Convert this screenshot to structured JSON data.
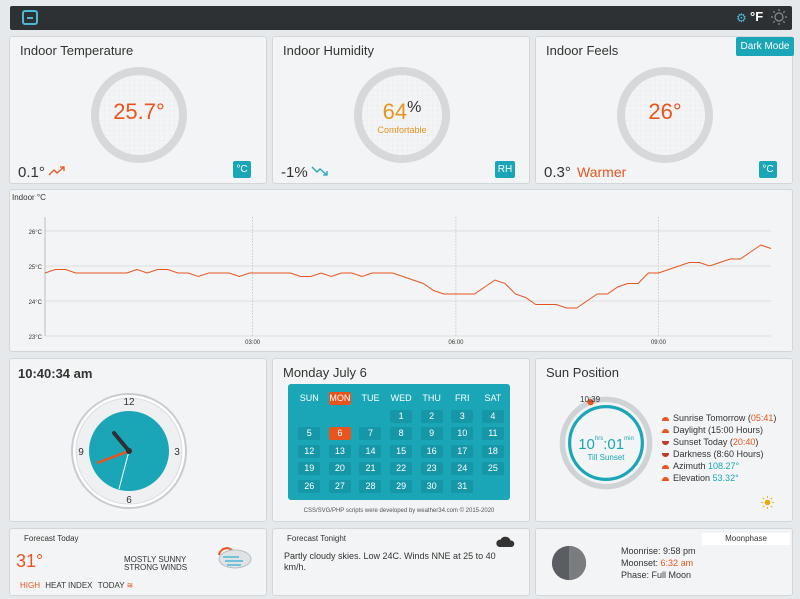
{
  "topbar": {
    "unit": "°F",
    "logo": "station-logo-icon",
    "toggle": "sun-icon"
  },
  "colors": {
    "accent": "#1aa6b7",
    "warm": "#e8541e",
    "comfort": "#e8941e",
    "bar": "#2e3134"
  },
  "temperature": {
    "title": "Indoor Temperature",
    "value": "25.7°",
    "change": "0.1°",
    "trend_icon": "trend-up-icon",
    "unit": "°C"
  },
  "humidity": {
    "title": "Indoor Humidity",
    "value": "64",
    "percent": "%",
    "status": "Comfortable",
    "change": "-1%",
    "trend_icon": "trend-down-icon",
    "unit": "RH"
  },
  "feels": {
    "title": "Indoor Feels",
    "value": "26°",
    "change": "0.3°",
    "status": "Warmer",
    "unit": "°C",
    "dark_mode": "Dark Mode"
  },
  "chart": {
    "label": "Indoor  °C",
    "chart_data": {
      "type": "line",
      "title": "",
      "xlabel": "",
      "ylabel": "°C",
      "ylim": [
        23,
        26
      ],
      "yticks": [
        "26°C",
        "25°C",
        "24°C",
        "23°C"
      ],
      "xticks": [
        "03:00",
        "06:00",
        "09:00"
      ],
      "grid": true,
      "series": [
        {
          "values": [
            24.8,
            24.9,
            24.9,
            24.8,
            24.8,
            24.8,
            24.8,
            24.8,
            24.8,
            24.9,
            24.8,
            24.9,
            24.9,
            24.8,
            24.8,
            24.7,
            24.8,
            24.8,
            24.8,
            24.7,
            24.8,
            24.8,
            24.8,
            24.8,
            24.8,
            24.7,
            24.7,
            24.8,
            24.7,
            24.8,
            24.8,
            24.7,
            24.8,
            24.8,
            24.8,
            24.7,
            24.6,
            24.5,
            24.3,
            24.2,
            24.2,
            24.2,
            24.2,
            24.4,
            24.6,
            24.5,
            24.2,
            24.1,
            23.9,
            23.9,
            23.9,
            23.8,
            23.8,
            24.0,
            24.2,
            24.2,
            24.4,
            24.5,
            24.5,
            24.8,
            24.8,
            24.9,
            25.0,
            25.1,
            25.1,
            25.0,
            25.1,
            25.2,
            25.2,
            25.4,
            25.6,
            25.5
          ]
        }
      ]
    }
  },
  "clock": {
    "time": "10:40:34 am",
    "numerals": [
      "12",
      "3",
      "6",
      "9"
    ]
  },
  "calendar": {
    "title": "Monday July 6",
    "days": [
      "SUN",
      "MON",
      "TUE",
      "WED",
      "THU",
      "FRI",
      "SAT"
    ],
    "today_index": 1,
    "cells": [
      "",
      "",
      "",
      "1",
      "2",
      "3",
      "4",
      "5",
      "6",
      "7",
      "8",
      "9",
      "10",
      "11",
      "12",
      "13",
      "14",
      "15",
      "16",
      "17",
      "18",
      "19",
      "20",
      "21",
      "22",
      "23",
      "24",
      "25",
      "26",
      "27",
      "28",
      "29",
      "30",
      "31",
      ""
    ],
    "today": "6",
    "credit": "CSS/SVG/PHP scripts were developed by weather34.com © 2015-2020"
  },
  "sun": {
    "title": "Sun Position",
    "dial_time": "10:39",
    "hrs": "10",
    "hrs_unit": "hrs",
    "mins": "01",
    "min_unit": "min",
    "till": "Till Sunset",
    "sunrise_label": "Sunrise Tomorrow",
    "sunrise": "05:41",
    "daylight": "Daylight (15:00 Hours)",
    "sunset_label": "Sunset Today",
    "sunset": "20:40",
    "darkness": "Darkness (8:60 Hours)",
    "azimuth_label": "Azimuth",
    "azimuth": "108.27°",
    "elevation_label": "Elevation",
    "elevation": "53.32°",
    "status_icon": "sun-icon"
  },
  "forecast_today": {
    "title": "Forecast Today",
    "temp": "31°",
    "conditions_1": "MOSTLY SUNNY",
    "conditions_2": "STRONG WINDS",
    "high": "HIGH",
    "heat_index": "HEAT INDEX",
    "today": "TODAY",
    "icon": "sunny-windy-icon"
  },
  "forecast_tonight": {
    "title": "Forecast Tonight",
    "text": "Partly cloudy skies. Low 24C. Winds NNE at 25 to 40 km/h.",
    "icon": "cloud-night-icon"
  },
  "moon": {
    "title": "Moonphase",
    "moonrise_label": "Moonrise:",
    "moonrise": "9:58 pm",
    "moonset_label": "Moonset:",
    "moonset": "6:32 am",
    "phase_label": "Phase:",
    "phase": "Full Moon"
  }
}
